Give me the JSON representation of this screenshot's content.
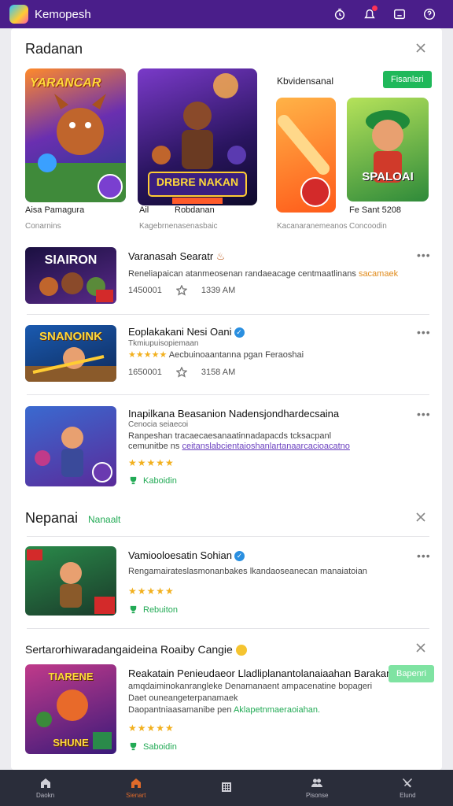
{
  "app": {
    "title": "Kemopesh"
  },
  "section1": {
    "title": "Radanan",
    "featured_label": "Kbvidensanal",
    "featured_button": "Fisanlari",
    "tiles": [
      {
        "name": "Aisa Pamagura",
        "sub": "Conarnins",
        "art": "YARANCAR"
      },
      {
        "name": "Robdanan",
        "sub": "Kagebrnenasenasbaic",
        "art": "DRBRE NAKAN",
        "prefix": "Ail"
      },
      {
        "name": "",
        "sub": "Kacanaranemeanos",
        "art": ""
      },
      {
        "name": "Fe Sant 5208",
        "sub": "Concoodin",
        "art": "SPALOAI"
      }
    ]
  },
  "rows": [
    {
      "art": "SIAIRON",
      "title": "Varanasah Searatr",
      "desc_a": "Reneliapaican atanmeosenan randaeacage centmaatlinans",
      "desc_link": "sacamaek",
      "downloads": "1450001",
      "time": "1339 AM"
    },
    {
      "art": "SNANOINK",
      "title": "Eoplakakani Nesi Oani",
      "meta": "Tkmiupuisopiemaan",
      "desc_a": "Aecbuinoaantanna pgan Feraoshai",
      "downloads": "1650001",
      "time": "3158 AM"
    },
    {
      "art": "",
      "title": "Inapilkana Beasanion Nadensjondhardecsaina",
      "meta": "Cenocia seiaecoi",
      "desc_a": "Ranpeshan tracaecaesanaatinnadapacds tcksacpanl",
      "desc_link": "ceitanslabcientaioshanlartanaarcacioacatno",
      "desc_pre": "cemunitbe ns",
      "award": "Kaboidin"
    }
  ],
  "section2": {
    "title": "Nepanai",
    "tag": "Nanaalt",
    "row": {
      "art": "",
      "title": "Vamiooloesatin Sohian",
      "desc_a": "Rengamairateslasmonanbakes lkandaoseanecan manaiatoian",
      "award": "Rebuiton"
    }
  },
  "section3": {
    "title": "Sertarorhiwaradangaideina Roaiby Cangie",
    "button": "Bapenri",
    "row": {
      "art": "SHUNE",
      "title": "Reakatain Penieudaeor Lladliplanantolanaiaahan Barakan",
      "desc_a": "amqdaiminokanrangleke Denamanaent ampacenatine bopageri",
      "desc_b": "Daet ouneangeterpanamaek",
      "desc_c": "Daopantniaasamanibe pen",
      "desc_link": "Aklapetnmaeraoiahan.",
      "award": "Saboidin"
    }
  },
  "nav": [
    {
      "label": "Daokn",
      "icon": "home-icon"
    },
    {
      "label": "Sienart",
      "icon": "home-icon"
    },
    {
      "label": "",
      "icon": "grid-icon"
    },
    {
      "label": "Pisonse",
      "icon": "people-icon"
    },
    {
      "label": "Elund",
      "icon": "tools-icon"
    }
  ],
  "colors": {
    "topbar": "#4a1e8a",
    "accent_green": "#1fb85a",
    "nav_bg": "#2a2d3a",
    "nav_active": "#e06a2a"
  }
}
